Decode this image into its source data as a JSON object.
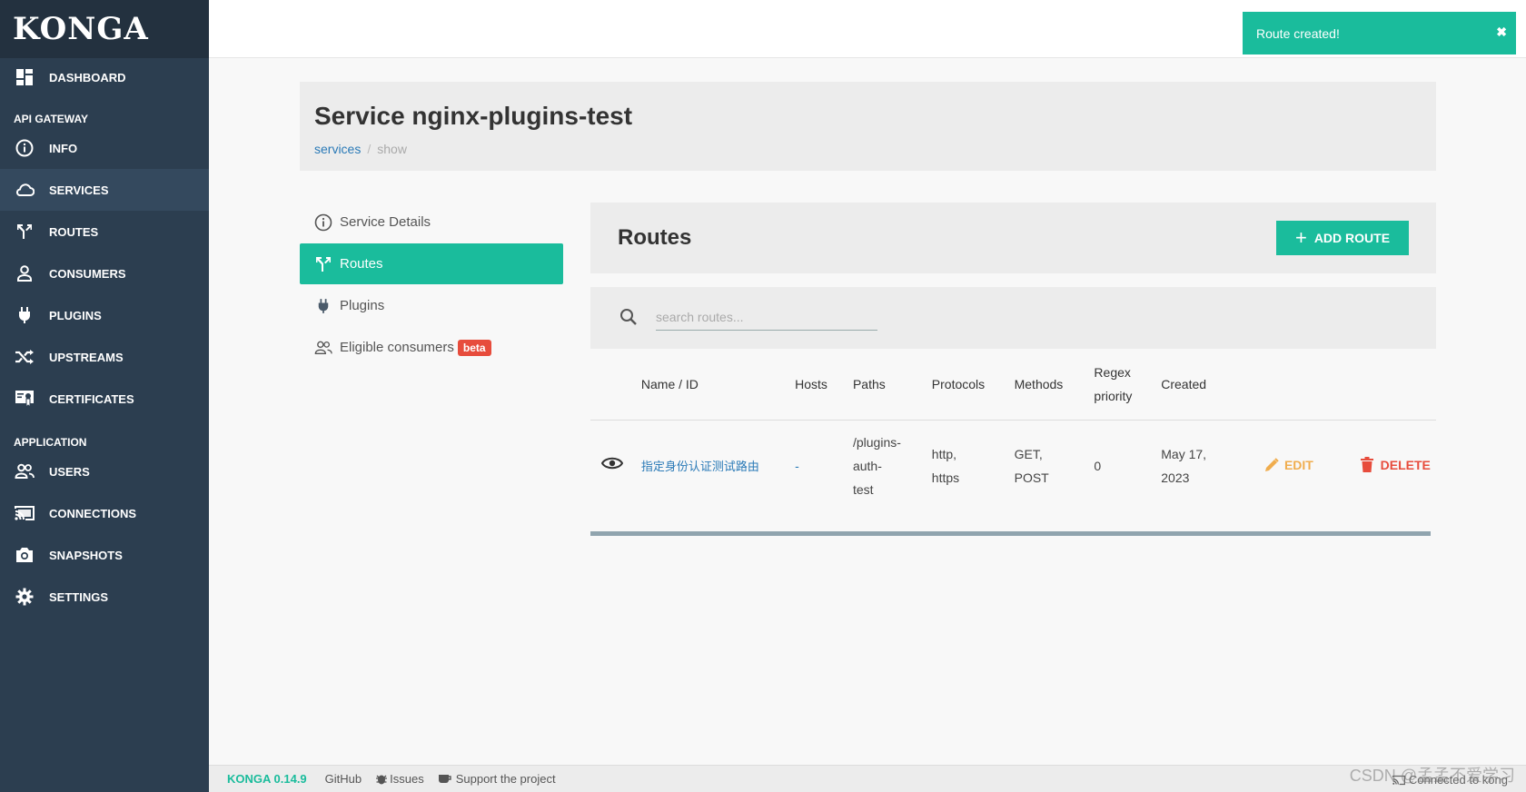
{
  "app": {
    "logo": "KONGA"
  },
  "sidebar": {
    "dashboard": "DASHBOARD",
    "sections": [
      {
        "title": "API GATEWAY"
      },
      {
        "title": "APPLICATION"
      }
    ],
    "gateway_items": [
      {
        "label": "INFO",
        "icon": "info-icon"
      },
      {
        "label": "SERVICES",
        "icon": "cloud-icon"
      },
      {
        "label": "ROUTES",
        "icon": "route-icon"
      },
      {
        "label": "CONSUMERS",
        "icon": "user-icon"
      },
      {
        "label": "PLUGINS",
        "icon": "plug-icon"
      },
      {
        "label": "UPSTREAMS",
        "icon": "shuffle-icon"
      },
      {
        "label": "CERTIFICATES",
        "icon": "certificate-icon"
      }
    ],
    "app_items": [
      {
        "label": "USERS",
        "icon": "users-icon"
      },
      {
        "label": "CONNECTIONS",
        "icon": "cast-icon"
      },
      {
        "label": "SNAPSHOTS",
        "icon": "camera-icon"
      },
      {
        "label": "SETTINGS",
        "icon": "gear-icon"
      }
    ],
    "active": "SERVICES"
  },
  "toast": {
    "message": "Route created!",
    "close": "✖"
  },
  "header": {
    "title": "Service nginx-plugins-test",
    "breadcrumb": {
      "link": "services",
      "separator": "/",
      "current": "show"
    }
  },
  "tabs": {
    "items": [
      {
        "label": "Service Details",
        "icon": "info-icon"
      },
      {
        "label": "Routes",
        "icon": "route-icon"
      },
      {
        "label": "Plugins",
        "icon": "plug-icon"
      },
      {
        "label": "Eligible consumers",
        "icon": "users-icon"
      }
    ],
    "badge": "beta",
    "active": "Routes"
  },
  "routes": {
    "title": "Routes",
    "add_button": "ADD ROUTE",
    "search_placeholder": "search routes...",
    "columns": {
      "name": "Name / ID",
      "hosts": "Hosts",
      "paths": "Paths",
      "protocols": "Protocols",
      "methods": "Methods",
      "regex_1": "Regex",
      "regex_2": "priority",
      "created": "Created"
    },
    "row": {
      "name": "指定身份认证测试路由",
      "hosts": "-",
      "paths_1": "/plugins-",
      "paths_2": "auth-",
      "paths_3": "test",
      "protocols_1": "http,",
      "protocols_2": "https",
      "methods_1": "GET,",
      "methods_2": "POST",
      "regex_priority": "0",
      "created_1": "May 17,",
      "created_2": "2023",
      "edit": "EDIT",
      "delete": "DELETE"
    }
  },
  "footer": {
    "version": "KONGA 0.14.9",
    "github": "GitHub",
    "issues": "Issues",
    "support": "Support the project",
    "connected": "Connected to kong",
    "watermark": "CSDN @孟孟不爱学习"
  },
  "colors": {
    "sidebar": "#2c3e50",
    "accent": "#1abc9c",
    "link": "#2a7ab7",
    "danger": "#e74c3c",
    "warning": "#f0ad4e"
  }
}
